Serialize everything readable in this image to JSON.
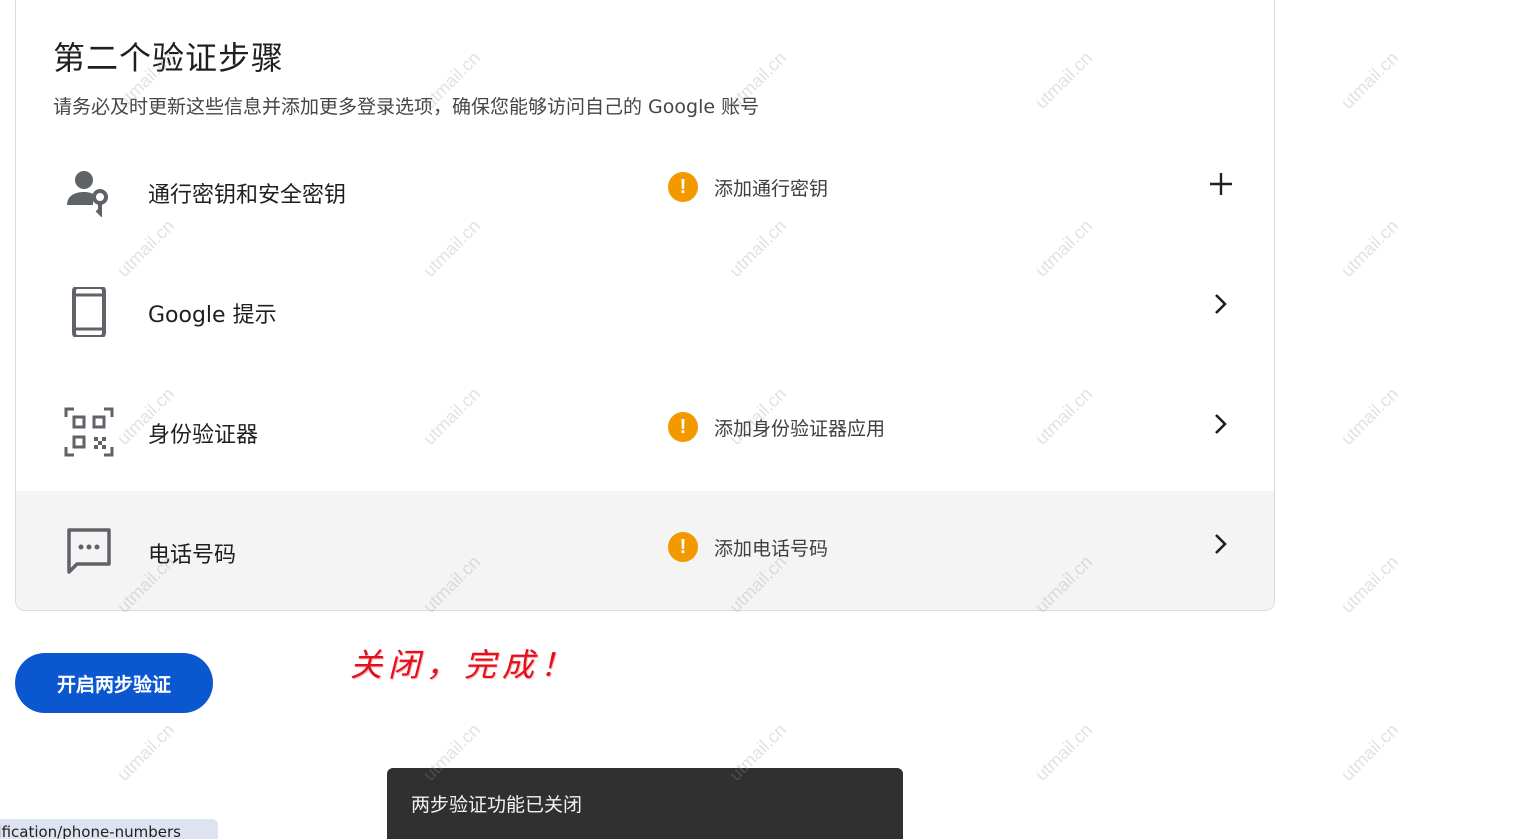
{
  "card": {
    "title": "第二个验证步骤",
    "subtitle": "请务必及时更新这些信息并添加更多登录选项，确保您能够访问自己的 Google 账号"
  },
  "rows": [
    {
      "icon": "person-key-icon",
      "label": "通行密钥和安全密钥",
      "status": "添加通行密钥",
      "action": "plus-icon"
    },
    {
      "icon": "smartphone-icon",
      "label": "Google 提示",
      "status": "",
      "action": "chevron-right-icon"
    },
    {
      "icon": "qr-code-icon",
      "label": "身份验证器",
      "status": "添加身份验证器应用",
      "action": "chevron-right-icon"
    },
    {
      "icon": "sms-icon",
      "label": "电话号码",
      "status": "添加电话号码",
      "action": "chevron-right-icon"
    }
  ],
  "warning_glyph": "!",
  "enable_button": "开启两步验证",
  "annotation": "关闭，完成！",
  "snackbar": "两步验证功能已关闭",
  "url_status": "erification/phone-numbers",
  "watermark": "utmail.cn",
  "colors": {
    "primary": "#0b57d0",
    "warning": "#f29900",
    "annotation": "#e0101c",
    "snackbar_bg": "#303030"
  }
}
